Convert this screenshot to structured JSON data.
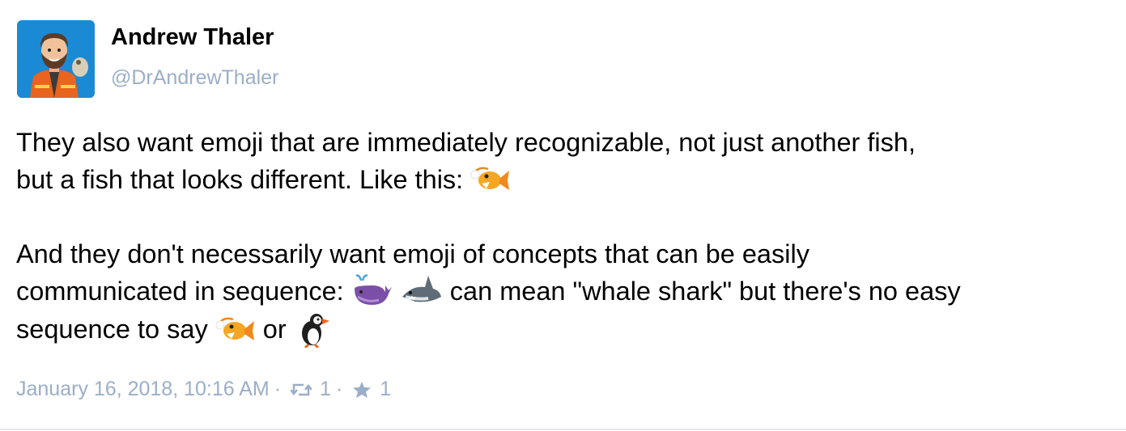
{
  "account": {
    "display_name": "Andrew Thaler",
    "handle": "@DrAndrewThaler"
  },
  "status": {
    "paragraph_1": {
      "line_1": "They also want emoji that are immediately recognizable, not just another fish,",
      "line_2": "but a fish that looks different. Like this:"
    },
    "paragraph_2": {
      "line_1": "And they don't necessarily want emoji of concepts that can be easily",
      "line_2_before": "communicated in sequence:",
      "line_2_after": "can mean \"whale shark\" but there's no easy",
      "line_3_before": "sequence to say",
      "line_3_middle": "or"
    },
    "emoji": [
      "anglerfish-emoji",
      "whale-emoji",
      "shark-emoji",
      "anglerfish-emoji",
      "puffin-emoji"
    ]
  },
  "meta": {
    "timestamp": "January 16, 2018, 10:16 AM",
    "separator": "·",
    "boost_count": "1",
    "favourite_count": "1"
  },
  "colors": {
    "text": "#000000",
    "muted": "#9baec8",
    "avatar_bg": "#1a8ad4",
    "divider": "#e6ebf0"
  }
}
